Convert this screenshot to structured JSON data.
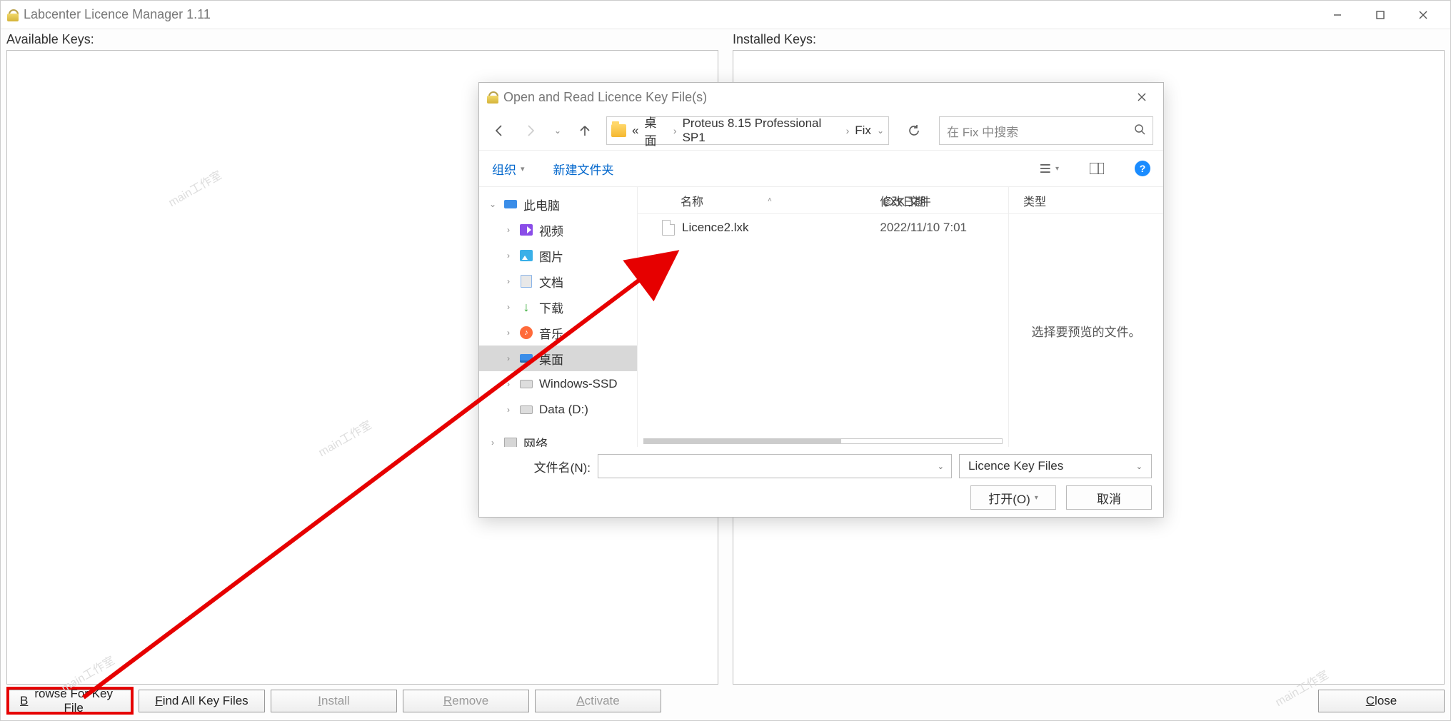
{
  "main_window": {
    "title": "Labcenter Licence Manager 1.11",
    "available_keys_label": "Available Keys:",
    "installed_keys_label": "Installed Keys:",
    "buttons": {
      "browse": "Browse For Key File",
      "find_all": "Find All Key Files",
      "install": "Install",
      "remove": "Remove",
      "activate": "Activate",
      "close": "Close"
    }
  },
  "file_dialog": {
    "title": "Open and Read Licence Key File(s)",
    "breadcrumb": {
      "prefix": "«",
      "segments": [
        "桌面",
        "Proteus 8.15 Professional SP1",
        "Fix"
      ]
    },
    "search_placeholder": "在 Fix 中搜索",
    "toolbar": {
      "organize": "组织",
      "new_folder": "新建文件夹"
    },
    "tree": {
      "root": "此电脑",
      "children": [
        "视频",
        "图片",
        "文档",
        "下载",
        "音乐",
        "桌面",
        "Windows-SSD",
        "Data (D:)"
      ],
      "network": "网络",
      "selected": "桌面"
    },
    "list": {
      "columns": {
        "name": "名称",
        "date": "修改日期",
        "type": "类型"
      },
      "rows": [
        {
          "name": "Licence2.lxk",
          "date": "2022/11/10 7:01",
          "type": "LXK 文件"
        }
      ]
    },
    "preview": {
      "type_header": "类型",
      "empty_text": "选择要预览的文件。"
    },
    "filename_label": "文件名(N):",
    "filter": "Licence Key Files",
    "open_btn": "打开(O)",
    "cancel_btn": "取消"
  },
  "watermark": "main工作室"
}
